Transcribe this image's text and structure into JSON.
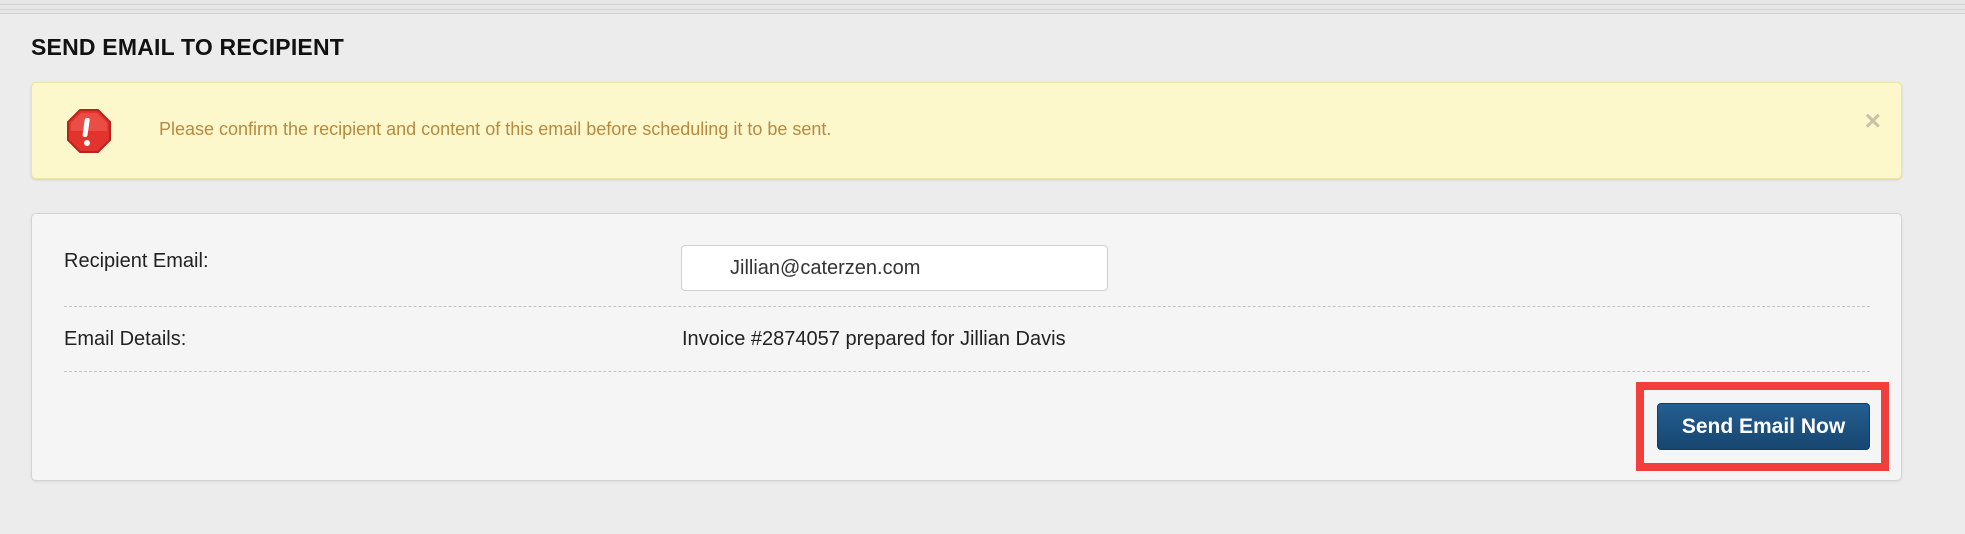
{
  "page": {
    "title": "SEND EMAIL TO RECIPIENT"
  },
  "alert": {
    "icon": "error-octagon-icon",
    "message": "Please confirm the recipient and content of this email before scheduling it to be sent.",
    "close_glyph": "×",
    "background_color": "#fdf7cc",
    "text_color": "#b68a3f"
  },
  "form": {
    "recipient_label": "Recipient Email:",
    "recipient_value": "Jillian@caterzen.com",
    "details_label": "Email Details:",
    "details_value": "Invoice #2874057 prepared for Jillian Davis"
  },
  "actions": {
    "send_label": "Send Email Now",
    "send_color": "#1d5281",
    "highlight_color": "#f1403b"
  }
}
